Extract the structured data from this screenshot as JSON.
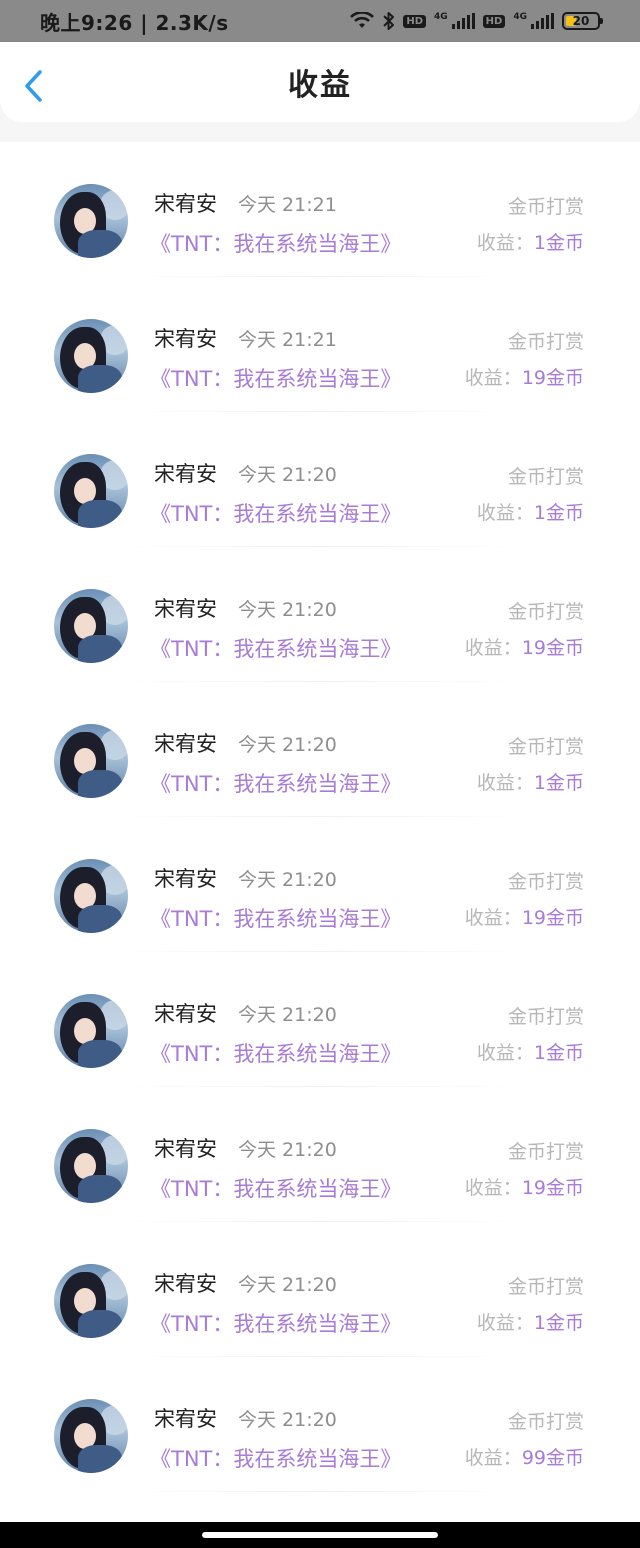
{
  "status": {
    "time": "晚上9:26 | 2.3K/s",
    "hd1": "HD",
    "net1": "4G",
    "hd2": "HD",
    "net2": "4G",
    "battery": "20"
  },
  "header": {
    "title": "收益"
  },
  "entries": [
    {
      "name": "宋宥安",
      "time": "今天 21:21",
      "book": "《TNT：我在系统当海王》",
      "type": "金币打赏",
      "earn_label": "收益：",
      "amount": "1金币"
    },
    {
      "name": "宋宥安",
      "time": "今天 21:21",
      "book": "《TNT：我在系统当海王》",
      "type": "金币打赏",
      "earn_label": "收益：",
      "amount": "19金币"
    },
    {
      "name": "宋宥安",
      "time": "今天 21:20",
      "book": "《TNT：我在系统当海王》",
      "type": "金币打赏",
      "earn_label": "收益：",
      "amount": "1金币"
    },
    {
      "name": "宋宥安",
      "time": "今天 21:20",
      "book": "《TNT：我在系统当海王》",
      "type": "金币打赏",
      "earn_label": "收益：",
      "amount": "19金币"
    },
    {
      "name": "宋宥安",
      "time": "今天 21:20",
      "book": "《TNT：我在系统当海王》",
      "type": "金币打赏",
      "earn_label": "收益：",
      "amount": "1金币"
    },
    {
      "name": "宋宥安",
      "time": "今天 21:20",
      "book": "《TNT：我在系统当海王》",
      "type": "金币打赏",
      "earn_label": "收益：",
      "amount": "19金币"
    },
    {
      "name": "宋宥安",
      "time": "今天 21:20",
      "book": "《TNT：我在系统当海王》",
      "type": "金币打赏",
      "earn_label": "收益：",
      "amount": "1金币"
    },
    {
      "name": "宋宥安",
      "time": "今天 21:20",
      "book": "《TNT：我在系统当海王》",
      "type": "金币打赏",
      "earn_label": "收益：",
      "amount": "19金币"
    },
    {
      "name": "宋宥安",
      "time": "今天 21:20",
      "book": "《TNT：我在系统当海王》",
      "type": "金币打赏",
      "earn_label": "收益：",
      "amount": "1金币"
    },
    {
      "name": "宋宥安",
      "time": "今天 21:20",
      "book": "《TNT：我在系统当海王》",
      "type": "金币打赏",
      "earn_label": "收益：",
      "amount": "99金币"
    }
  ],
  "colors": {
    "accent": "#a77bd6",
    "back": "#2f9bf0"
  },
  "icons": {
    "back": "chevron-left-icon",
    "avatar": "user-avatar"
  }
}
